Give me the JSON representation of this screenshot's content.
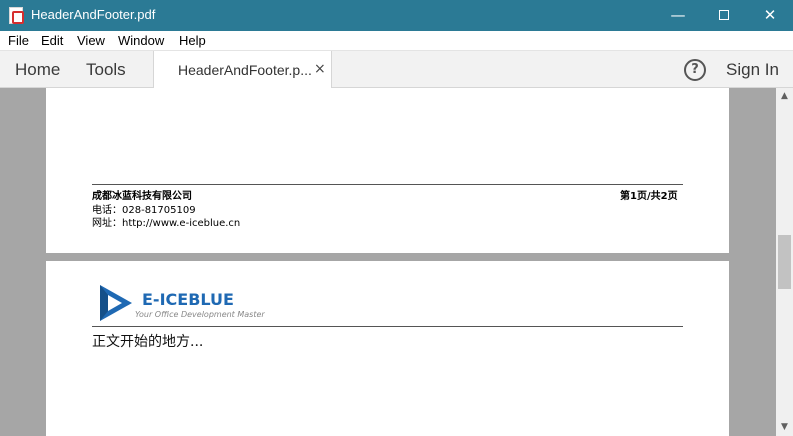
{
  "window": {
    "title": "HeaderAndFooter.pdf",
    "minimize_glyph": "—",
    "close_glyph": "✕"
  },
  "menu": [
    "File",
    "Edit",
    "View",
    "Window",
    "Help"
  ],
  "toolbar": {
    "home": "Home",
    "tools": "Tools",
    "doc_tab": "HeaderAndFooter.p...",
    "tab_close": "×",
    "help": "?",
    "sign_in": "Sign In"
  },
  "page1": {
    "footer_company": "成都冰蓝科技有限公司",
    "footer_phone": "电话：028-81705109",
    "footer_site": "网址：http://www.e-iceblue.cn",
    "page_number": "第1页/共2页"
  },
  "page2": {
    "brand": "E-ICEBLUE",
    "tagline": "Your Office Development Master",
    "body": "正文开始的地方..."
  },
  "scrollbar": {
    "up": "▲",
    "down": "▼"
  },
  "colors": {
    "titlebar": "#2b7a95",
    "viewer_bg": "#a6a6a6",
    "brand_blue": "#1f69b3"
  },
  "icons": {
    "app": "pdf-file-icon",
    "help": "help-circle-icon",
    "logo": "e-iceblue-logo-icon"
  }
}
